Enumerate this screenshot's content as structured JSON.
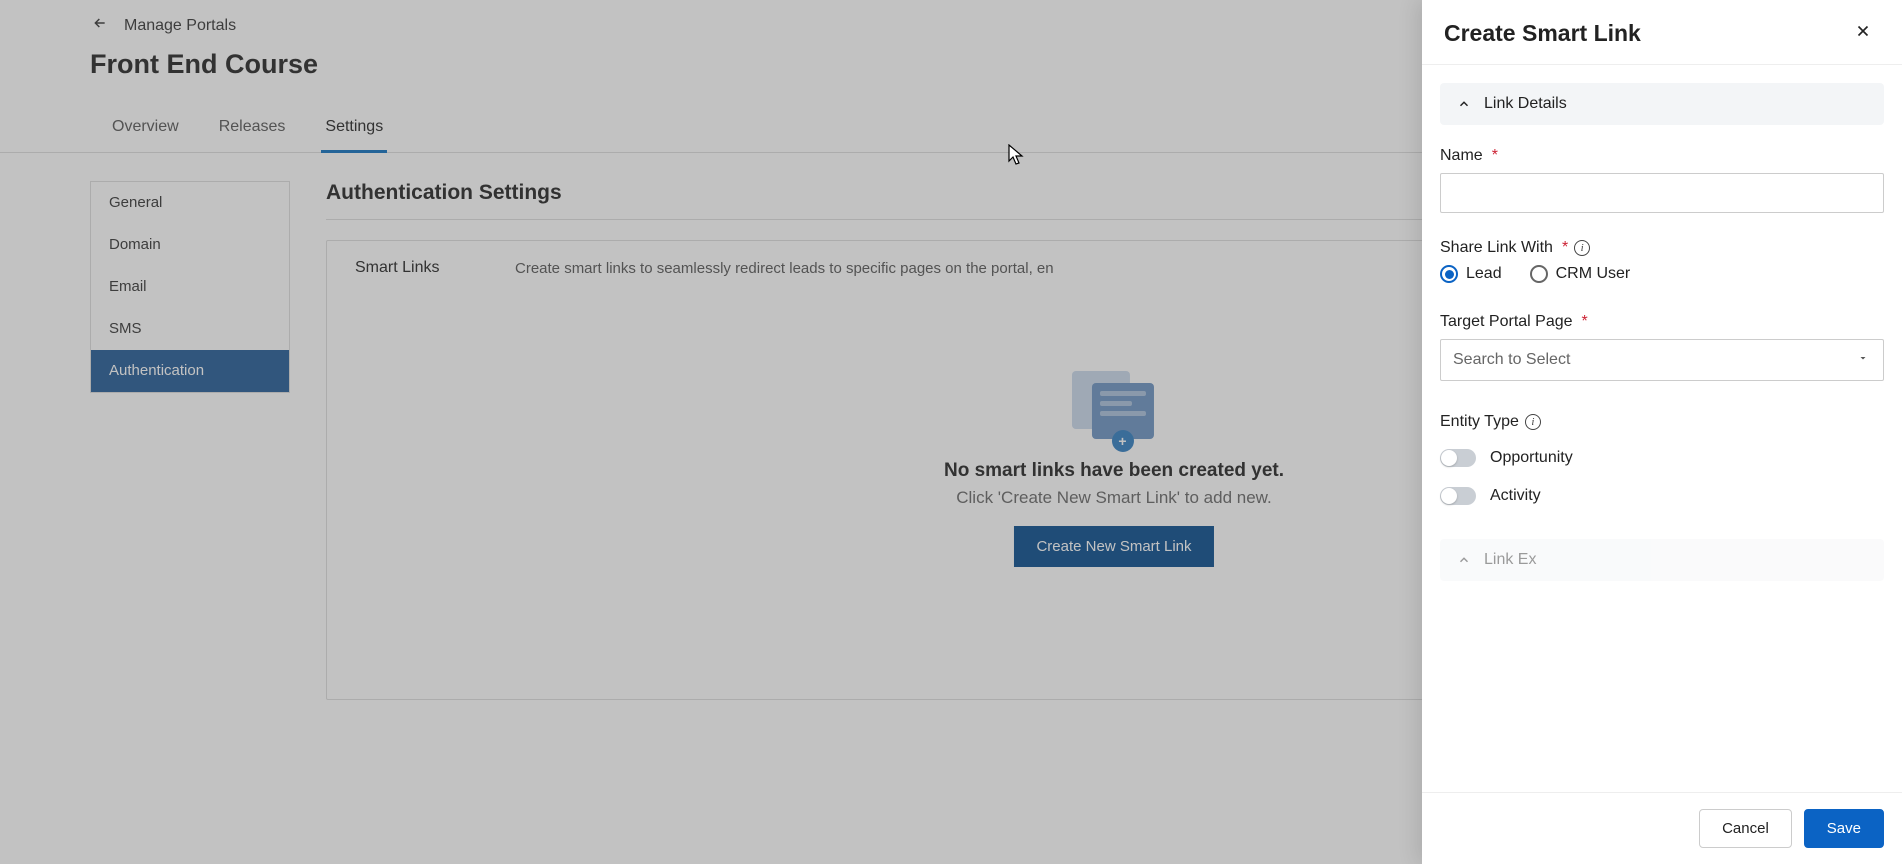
{
  "breadcrumb": {
    "label": "Manage Portals"
  },
  "page": {
    "title": "Front End Course"
  },
  "tabs": {
    "overview": "Overview",
    "releases": "Releases",
    "settings": "Settings"
  },
  "sidebar": {
    "general": "General",
    "domain": "Domain",
    "email": "Email",
    "sms": "SMS",
    "authentication": "Authentication"
  },
  "main": {
    "section_title": "Authentication Settings",
    "card_title": "Smart Links",
    "card_desc": "Create smart links to seamlessly redirect leads to specific pages on the portal, en",
    "empty_title": "No smart links have been created yet.",
    "empty_desc": "Click 'Create New Smart Link' to add new.",
    "create_btn": "Create New Smart Link"
  },
  "panel": {
    "title": "Create Smart Link",
    "section_link_details": "Link Details",
    "name_label": "Name",
    "name_value": "",
    "share_label": "Share Link With",
    "share_options": {
      "lead": "Lead",
      "crm_user": "CRM User"
    },
    "target_label": "Target Portal Page",
    "target_placeholder": "Search to Select",
    "entity_label": "Entity Type",
    "toggle_opportunity": "Opportunity",
    "toggle_activity": "Activity",
    "section_link_expiry_prefix": "Link Ex",
    "cancel": "Cancel",
    "save": "Save"
  }
}
